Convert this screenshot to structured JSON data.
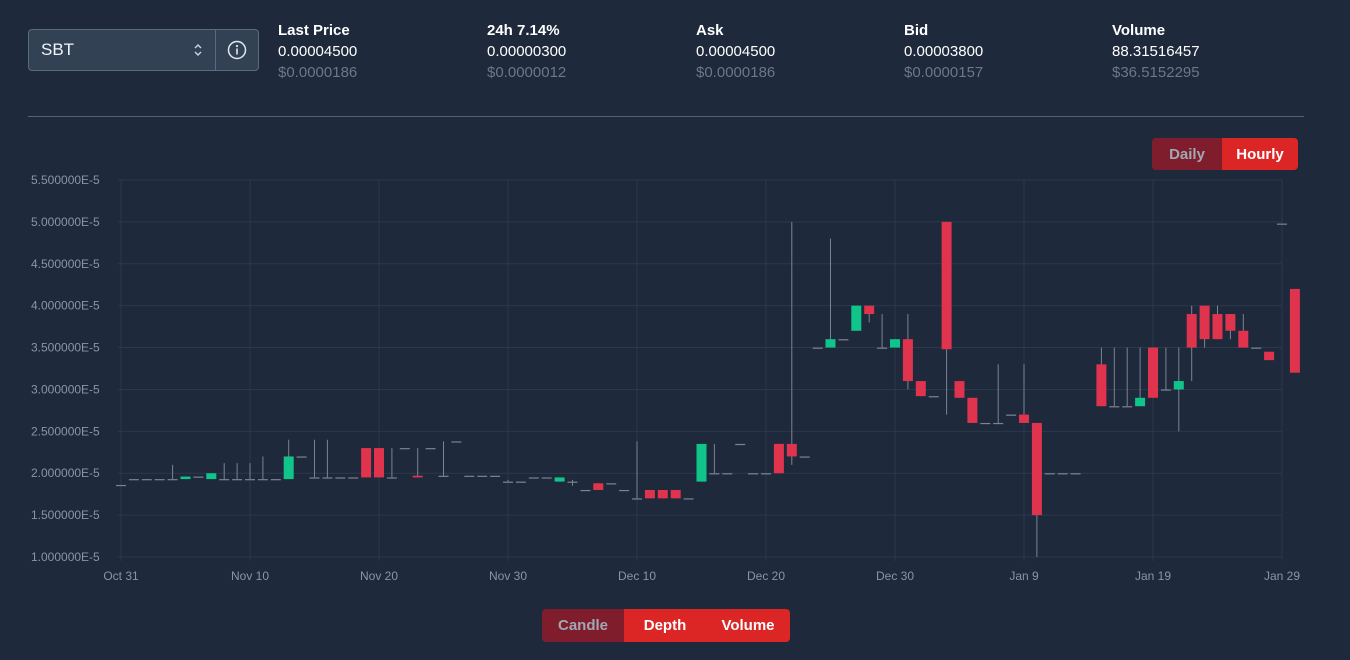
{
  "pair": {
    "name": "SBT"
  },
  "stats": [
    {
      "label": "Last Price",
      "label_value": "",
      "value": "0.00004500",
      "usd": "$0.0000186",
      "green": false
    },
    {
      "label": "24h",
      "label_value": "7.14%",
      "value": "0.00000300",
      "usd": "$0.0000012",
      "green": true
    },
    {
      "label": "Ask",
      "label_value": "",
      "value": "0.00004500",
      "usd": "$0.0000186",
      "green": false
    },
    {
      "label": "Bid",
      "label_value": "",
      "value": "0.00003800",
      "usd": "$0.0000157",
      "green": false
    },
    {
      "label": "Volume",
      "label_value": "",
      "value": "88.31516457",
      "usd": "$36.5152295",
      "green": false
    }
  ],
  "period_toggle": {
    "daily": "Daily",
    "hourly": "Hourly",
    "selected": "Hourly"
  },
  "view_toggle": {
    "candle": "Candle",
    "depth": "Depth",
    "volume": "Volume",
    "selected": "Candle"
  },
  "colors": {
    "up": "#10c58a",
    "down": "#e0334e",
    "background": "#1e293b",
    "grid": "#2b394c"
  },
  "chart_data": {
    "type": "candlestick",
    "x_start": "2021-10-31",
    "x_end": "2022-01-29",
    "ylim": [
      1e-05,
      5.5e-05
    ],
    "y_ticks": [
      {
        "value": 5.5e-05,
        "label": "5.500000E-5"
      },
      {
        "value": 5e-05,
        "label": "5.000000E-5"
      },
      {
        "value": 4.5e-05,
        "label": "4.500000E-5"
      },
      {
        "value": 4e-05,
        "label": "4.000000E-5"
      },
      {
        "value": 3.5e-05,
        "label": "3.500000E-5"
      },
      {
        "value": 3e-05,
        "label": "3.000000E-5"
      },
      {
        "value": 2.5e-05,
        "label": "2.500000E-5"
      },
      {
        "value": 2e-05,
        "label": "2.000000E-5"
      },
      {
        "value": 1.5e-05,
        "label": "1.500000E-5"
      },
      {
        "value": 1e-05,
        "label": "1.000000E-5"
      }
    ],
    "x_ticks": [
      {
        "date": "2021-10-31",
        "label": "Oct 31"
      },
      {
        "date": "2021-11-10",
        "label": "Nov 10"
      },
      {
        "date": "2021-11-20",
        "label": "Nov 20"
      },
      {
        "date": "2021-11-30",
        "label": "Nov 30"
      },
      {
        "date": "2021-12-10",
        "label": "Dec 10"
      },
      {
        "date": "2021-12-20",
        "label": "Dec 20"
      },
      {
        "date": "2021-12-30",
        "label": "Dec 30"
      },
      {
        "date": "2022-01-09",
        "label": "Jan 9"
      },
      {
        "date": "2022-01-19",
        "label": "Jan 19"
      },
      {
        "date": "2022-01-29",
        "label": "Jan 29"
      }
    ],
    "candles": [
      {
        "date": "2021-10-31",
        "open": 1.86e-05,
        "high": 1.86e-05,
        "low": 1.86e-05,
        "close": 1.86e-05
      },
      {
        "date": "2021-11-01",
        "open": 1.93e-05,
        "high": 1.93e-05,
        "low": 1.93e-05,
        "close": 1.93e-05
      },
      {
        "date": "2021-11-02",
        "open": 1.93e-05,
        "high": 1.93e-05,
        "low": 1.93e-05,
        "close": 1.93e-05
      },
      {
        "date": "2021-11-03",
        "open": 1.93e-05,
        "high": 1.93e-05,
        "low": 1.93e-05,
        "close": 1.93e-05
      },
      {
        "date": "2021-11-04",
        "open": 1.93e-05,
        "high": 2.1e-05,
        "low": 1.93e-05,
        "close": 1.93e-05
      },
      {
        "date": "2021-11-05",
        "open": 1.93e-05,
        "high": 1.96e-05,
        "low": 1.93e-05,
        "close": 1.96e-05
      },
      {
        "date": "2021-11-06",
        "open": 1.96e-05,
        "high": 1.96e-05,
        "low": 1.96e-05,
        "close": 1.96e-05
      },
      {
        "date": "2021-11-07",
        "open": 1.93e-05,
        "high": 2e-05,
        "low": 1.93e-05,
        "close": 2e-05
      },
      {
        "date": "2021-11-08",
        "open": 1.93e-05,
        "high": 2.12e-05,
        "low": 1.93e-05,
        "close": 1.93e-05
      },
      {
        "date": "2021-11-09",
        "open": 1.93e-05,
        "high": 2.12e-05,
        "low": 1.93e-05,
        "close": 1.93e-05
      },
      {
        "date": "2021-11-10",
        "open": 1.93e-05,
        "high": 2.12e-05,
        "low": 1.93e-05,
        "close": 1.93e-05
      },
      {
        "date": "2021-11-11",
        "open": 1.93e-05,
        "high": 2.2e-05,
        "low": 1.93e-05,
        "close": 1.93e-05
      },
      {
        "date": "2021-11-12",
        "open": 1.93e-05,
        "high": 1.93e-05,
        "low": 1.93e-05,
        "close": 1.93e-05
      },
      {
        "date": "2021-11-13",
        "open": 1.93e-05,
        "high": 2.4e-05,
        "low": 1.93e-05,
        "close": 2.2e-05
      },
      {
        "date": "2021-11-14",
        "open": 2.2e-05,
        "high": 2.2e-05,
        "low": 2.2e-05,
        "close": 2.2e-05
      },
      {
        "date": "2021-11-15",
        "open": 1.95e-05,
        "high": 2.4e-05,
        "low": 1.95e-05,
        "close": 1.95e-05
      },
      {
        "date": "2021-11-16",
        "open": 1.95e-05,
        "high": 2.4e-05,
        "low": 1.95e-05,
        "close": 1.95e-05
      },
      {
        "date": "2021-11-17",
        "open": 1.95e-05,
        "high": 1.95e-05,
        "low": 1.95e-05,
        "close": 1.95e-05
      },
      {
        "date": "2021-11-18",
        "open": 1.95e-05,
        "high": 1.95e-05,
        "low": 1.95e-05,
        "close": 1.95e-05
      },
      {
        "date": "2021-11-19",
        "open": 2.3e-05,
        "high": 2.3e-05,
        "low": 1.95e-05,
        "close": 1.95e-05
      },
      {
        "date": "2021-11-20",
        "open": 2.3e-05,
        "high": 2.3e-05,
        "low": 1.95e-05,
        "close": 1.95e-05
      },
      {
        "date": "2021-11-21",
        "open": 1.95e-05,
        "high": 2.3e-05,
        "low": 1.95e-05,
        "close": 1.95e-05
      },
      {
        "date": "2021-11-22",
        "open": 2.3e-05,
        "high": 2.3e-05,
        "low": 2.3e-05,
        "close": 2.3e-05
      },
      {
        "date": "2021-11-23",
        "open": 1.97e-05,
        "high": 2.3e-05,
        "low": 1.95e-05,
        "close": 1.95e-05
      },
      {
        "date": "2021-11-24",
        "open": 2.3e-05,
        "high": 2.3e-05,
        "low": 2.3e-05,
        "close": 2.3e-05
      },
      {
        "date": "2021-11-25",
        "open": 1.97e-05,
        "high": 2.38e-05,
        "low": 1.97e-05,
        "close": 1.97e-05
      },
      {
        "date": "2021-11-26",
        "open": 2.38e-05,
        "high": 2.38e-05,
        "low": 2.38e-05,
        "close": 2.38e-05
      },
      {
        "date": "2021-11-27",
        "open": 1.97e-05,
        "high": 1.97e-05,
        "low": 1.97e-05,
        "close": 1.97e-05
      },
      {
        "date": "2021-11-28",
        "open": 1.97e-05,
        "high": 1.97e-05,
        "low": 1.97e-05,
        "close": 1.97e-05
      },
      {
        "date": "2021-11-29",
        "open": 1.97e-05,
        "high": 1.97e-05,
        "low": 1.97e-05,
        "close": 1.97e-05
      },
      {
        "date": "2021-11-30",
        "open": 1.9e-05,
        "high": 1.92e-05,
        "low": 1.9e-05,
        "close": 1.9e-05
      },
      {
        "date": "2021-12-01",
        "open": 1.9e-05,
        "high": 1.9e-05,
        "low": 1.9e-05,
        "close": 1.9e-05
      },
      {
        "date": "2021-12-02",
        "open": 1.95e-05,
        "high": 1.95e-05,
        "low": 1.95e-05,
        "close": 1.95e-05
      },
      {
        "date": "2021-12-03",
        "open": 1.95e-05,
        "high": 1.95e-05,
        "low": 1.95e-05,
        "close": 1.95e-05
      },
      {
        "date": "2021-12-04",
        "open": 1.9e-05,
        "high": 1.95e-05,
        "low": 1.9e-05,
        "close": 1.95e-05
      },
      {
        "date": "2021-12-05",
        "open": 1.9e-05,
        "high": 1.92e-05,
        "low": 1.85e-05,
        "close": 1.9e-05
      },
      {
        "date": "2021-12-06",
        "open": 1.8e-05,
        "high": 1.8e-05,
        "low": 1.8e-05,
        "close": 1.8e-05
      },
      {
        "date": "2021-12-07",
        "open": 1.88e-05,
        "high": 1.88e-05,
        "low": 1.8e-05,
        "close": 1.8e-05
      },
      {
        "date": "2021-12-08",
        "open": 1.88e-05,
        "high": 1.88e-05,
        "low": 1.88e-05,
        "close": 1.88e-05
      },
      {
        "date": "2021-12-09",
        "open": 1.8e-05,
        "high": 1.8e-05,
        "low": 1.8e-05,
        "close": 1.8e-05
      },
      {
        "date": "2021-12-10",
        "open": 1.7e-05,
        "high": 2.38e-05,
        "low": 1.7e-05,
        "close": 1.7e-05
      },
      {
        "date": "2021-12-11",
        "open": 1.8e-05,
        "high": 1.8e-05,
        "low": 1.7e-05,
        "close": 1.7e-05
      },
      {
        "date": "2021-12-12",
        "open": 1.8e-05,
        "high": 1.8e-05,
        "low": 1.7e-05,
        "close": 1.7e-05
      },
      {
        "date": "2021-12-13",
        "open": 1.8e-05,
        "high": 1.8e-05,
        "low": 1.7e-05,
        "close": 1.7e-05
      },
      {
        "date": "2021-12-14",
        "open": 1.7e-05,
        "high": 1.7e-05,
        "low": 1.7e-05,
        "close": 1.7e-05
      },
      {
        "date": "2021-12-15",
        "open": 1.9e-05,
        "high": 2.35e-05,
        "low": 1.9e-05,
        "close": 2.35e-05
      },
      {
        "date": "2021-12-16",
        "open": 2e-05,
        "high": 2.35e-05,
        "low": 2e-05,
        "close": 2e-05
      },
      {
        "date": "2021-12-17",
        "open": 2e-05,
        "high": 2e-05,
        "low": 2e-05,
        "close": 2e-05
      },
      {
        "date": "2021-12-18",
        "open": 2.35e-05,
        "high": 2.35e-05,
        "low": 2.35e-05,
        "close": 2.35e-05
      },
      {
        "date": "2021-12-19",
        "open": 2e-05,
        "high": 2e-05,
        "low": 2e-05,
        "close": 2e-05
      },
      {
        "date": "2021-12-20",
        "open": 2e-05,
        "high": 2e-05,
        "low": 2e-05,
        "close": 2e-05
      },
      {
        "date": "2021-12-21",
        "open": 2.35e-05,
        "high": 2.35e-05,
        "low": 2e-05,
        "close": 2e-05
      },
      {
        "date": "2021-12-22",
        "open": 2.35e-05,
        "high": 5e-05,
        "low": 2.1e-05,
        "close": 2.2e-05
      },
      {
        "date": "2021-12-23",
        "open": 2.2e-05,
        "high": 2.2e-05,
        "low": 2.2e-05,
        "close": 2.2e-05
      },
      {
        "date": "2021-12-24",
        "open": 3.5e-05,
        "high": 3.5e-05,
        "low": 3.5e-05,
        "close": 3.5e-05
      },
      {
        "date": "2021-12-25",
        "open": 3.5e-05,
        "high": 4.8e-05,
        "low": 3.5e-05,
        "close": 3.6e-05
      },
      {
        "date": "2021-12-26",
        "open": 3.6e-05,
        "high": 3.6e-05,
        "low": 3.6e-05,
        "close": 3.6e-05
      },
      {
        "date": "2021-12-27",
        "open": 3.7e-05,
        "high": 4e-05,
        "low": 3.7e-05,
        "close": 4e-05
      },
      {
        "date": "2021-12-28",
        "open": 4e-05,
        "high": 4e-05,
        "low": 3.8e-05,
        "close": 3.9e-05
      },
      {
        "date": "2021-12-29",
        "open": 3.5e-05,
        "high": 3.9e-05,
        "low": 3.5e-05,
        "close": 3.5e-05
      },
      {
        "date": "2021-12-30",
        "open": 3.5e-05,
        "high": 3.6e-05,
        "low": 3.5e-05,
        "close": 3.6e-05
      },
      {
        "date": "2021-12-31",
        "open": 3.6e-05,
        "high": 3.9e-05,
        "low": 3e-05,
        "close": 3.1e-05
      },
      {
        "date": "2022-01-01",
        "open": 3.1e-05,
        "high": 3.1e-05,
        "low": 2.92e-05,
        "close": 2.92e-05
      },
      {
        "date": "2022-01-02",
        "open": 2.92e-05,
        "high": 2.92e-05,
        "low": 2.92e-05,
        "close": 2.92e-05
      },
      {
        "date": "2022-01-03",
        "open": 5e-05,
        "high": 5e-05,
        "low": 2.7e-05,
        "close": 3.48e-05
      },
      {
        "date": "2022-01-04",
        "open": 3.1e-05,
        "high": 3.1e-05,
        "low": 2.9e-05,
        "close": 2.9e-05
      },
      {
        "date": "2022-01-05",
        "open": 2.9e-05,
        "high": 2.9e-05,
        "low": 2.6e-05,
        "close": 2.6e-05
      },
      {
        "date": "2022-01-06",
        "open": 2.6e-05,
        "high": 2.6e-05,
        "low": 2.6e-05,
        "close": 2.6e-05
      },
      {
        "date": "2022-01-07",
        "open": 2.6e-05,
        "high": 3.3e-05,
        "low": 2.6e-05,
        "close": 2.6e-05
      },
      {
        "date": "2022-01-08",
        "open": 2.7e-05,
        "high": 2.7e-05,
        "low": 2.7e-05,
        "close": 2.7e-05
      },
      {
        "date": "2022-01-09",
        "open": 2.7e-05,
        "high": 3.3e-05,
        "low": 2.6e-05,
        "close": 2.6e-05
      },
      {
        "date": "2022-01-10",
        "open": 2.6e-05,
        "high": 2.6e-05,
        "low": 1e-05,
        "close": 1.5e-05
      },
      {
        "date": "2022-01-11",
        "open": 2e-05,
        "high": 2e-05,
        "low": 2e-05,
        "close": 2e-05
      },
      {
        "date": "2022-01-12",
        "open": 2e-05,
        "high": 2e-05,
        "low": 2e-05,
        "close": 2e-05
      },
      {
        "date": "2022-01-13",
        "open": 2e-05,
        "high": 2e-05,
        "low": 2e-05,
        "close": 2e-05
      },
      {
        "date": "2022-01-15",
        "open": 3.3e-05,
        "high": 3.5e-05,
        "low": 2.8e-05,
        "close": 2.8e-05
      },
      {
        "date": "2022-01-16",
        "open": 2.8e-05,
        "high": 3.5e-05,
        "low": 2.8e-05,
        "close": 2.8e-05
      },
      {
        "date": "2022-01-17",
        "open": 2.8e-05,
        "high": 3.5e-05,
        "low": 2.8e-05,
        "close": 2.8e-05
      },
      {
        "date": "2022-01-18",
        "open": 2.8e-05,
        "high": 3.5e-05,
        "low": 2.8e-05,
        "close": 2.9e-05
      },
      {
        "date": "2022-01-19",
        "open": 3.5e-05,
        "high": 3.5e-05,
        "low": 2.9e-05,
        "close": 2.9e-05
      },
      {
        "date": "2022-01-20",
        "open": 3e-05,
        "high": 3.5e-05,
        "low": 3e-05,
        "close": 3e-05
      },
      {
        "date": "2022-01-21",
        "open": 3e-05,
        "high": 3.5e-05,
        "low": 2.5e-05,
        "close": 3.1e-05
      },
      {
        "date": "2022-01-22",
        "open": 3.9e-05,
        "high": 4e-05,
        "low": 3.1e-05,
        "close": 3.5e-05
      },
      {
        "date": "2022-01-23",
        "open": 4e-05,
        "high": 4e-05,
        "low": 3.5e-05,
        "close": 3.6e-05
      },
      {
        "date": "2022-01-24",
        "open": 3.9e-05,
        "high": 4e-05,
        "low": 3.6e-05,
        "close": 3.6e-05
      },
      {
        "date": "2022-01-25",
        "open": 3.9e-05,
        "high": 3.9e-05,
        "low": 3.6e-05,
        "close": 3.7e-05
      },
      {
        "date": "2022-01-26",
        "open": 3.7e-05,
        "high": 3.9e-05,
        "low": 3.5e-05,
        "close": 3.5e-05
      },
      {
        "date": "2022-01-27",
        "open": 3.5e-05,
        "high": 3.5e-05,
        "low": 3.5e-05,
        "close": 3.5e-05
      },
      {
        "date": "2022-01-28",
        "open": 3.45e-05,
        "high": 3.45e-05,
        "low": 3.35e-05,
        "close": 3.35e-05
      },
      {
        "date": "2022-01-29",
        "open": 4.98e-05,
        "high": 4.98e-05,
        "low": 4.98e-05,
        "close": 4.98e-05
      },
      {
        "date": "2022-01-30",
        "open": 4.2e-05,
        "high": 4.2e-05,
        "low": 3.2e-05,
        "close": 3.2e-05
      }
    ]
  }
}
